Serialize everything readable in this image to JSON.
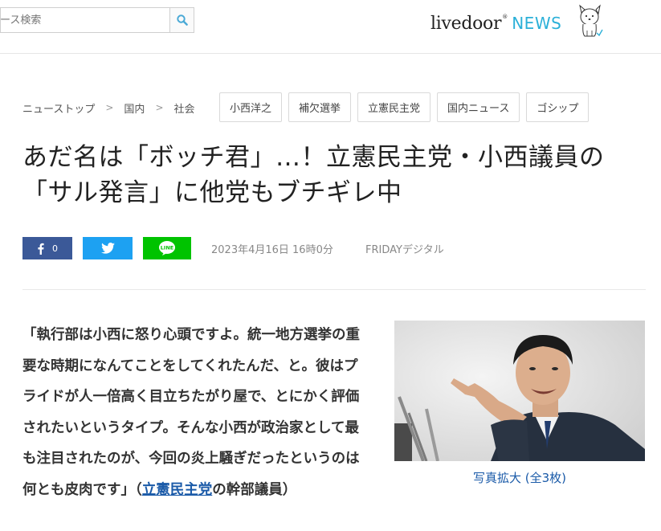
{
  "header": {
    "search_placeholder": "ュース検索",
    "logo_text": "livedoor",
    "logo_reg": "®",
    "logo_news": "NEWS"
  },
  "breadcrumb": {
    "items": [
      "ニューストップ",
      "国内",
      "社会"
    ],
    "separator": ">"
  },
  "tags": [
    "小西洋之",
    "補欠選挙",
    "立憲民主党",
    "国内ニュース",
    "ゴシップ"
  ],
  "article": {
    "title": "あだ名は「ボッチ君」…！立憲民主党・小西議員の「サル発言」に他党もブチギレ中",
    "date": "2023年4月16日 16時0分",
    "source": "FRIDAYデジタル",
    "share": {
      "fb_count": "0"
    },
    "body_lead": "「執行部は小西に怒り心頭ですよ。統一地方選挙の重要な時期になんてことをしてくれたんだ、と。彼はプライドが人一倍高く目立ちたがり屋で、とにかく評価されたいというタイプ。そんな小西が政治家として最も注目されたのが、今回の炎上騒ぎだったというのは何とも皮肉です」（",
    "body_link": "立憲民主党",
    "body_tail": "の幹部議員）",
    "photo_caption": "写真拡大 (全3枚)"
  },
  "colors": {
    "facebook": "#3b5998",
    "twitter": "#1da1f2",
    "line": "#00c300",
    "news_accent": "#2bb0d8",
    "link": "#1a5aa8"
  }
}
